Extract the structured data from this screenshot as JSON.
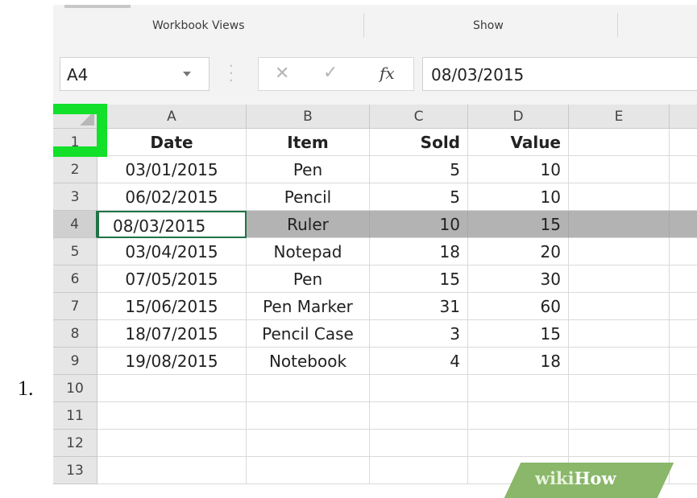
{
  "step_number": "1.",
  "ribbon": {
    "groups": [
      "Workbook Views",
      "Show"
    ]
  },
  "formula_bar": {
    "name_box": "A4",
    "cancel_icon": "✕",
    "enter_icon": "✓",
    "fx_label": "fx",
    "value": "08/03/2015"
  },
  "columns": [
    "A",
    "B",
    "C",
    "D",
    "E"
  ],
  "rows": [
    {
      "num": "1",
      "cells": [
        "Date",
        "Item",
        "Sold",
        "Value",
        ""
      ]
    },
    {
      "num": "2",
      "cells": [
        "03/01/2015",
        "Pen",
        "5",
        "10",
        ""
      ]
    },
    {
      "num": "3",
      "cells": [
        "06/02/2015",
        "Pencil",
        "5",
        "10",
        ""
      ]
    },
    {
      "num": "4",
      "cells": [
        "08/03/2015",
        "Ruler",
        "10",
        "15",
        ""
      ]
    },
    {
      "num": "5",
      "cells": [
        "03/04/2015",
        "Notepad",
        "18",
        "20",
        ""
      ]
    },
    {
      "num": "6",
      "cells": [
        "07/05/2015",
        "Pen",
        "15",
        "30",
        ""
      ]
    },
    {
      "num": "7",
      "cells": [
        "15/06/2015",
        "Pen Marker",
        "31",
        "60",
        ""
      ]
    },
    {
      "num": "8",
      "cells": [
        "18/07/2015",
        "Pencil Case",
        "3",
        "15",
        ""
      ]
    },
    {
      "num": "9",
      "cells": [
        "19/08/2015",
        "Notebook",
        "4",
        "18",
        ""
      ]
    },
    {
      "num": "10",
      "cells": [
        "",
        "",
        "",
        "",
        ""
      ]
    },
    {
      "num": "11",
      "cells": [
        "",
        "",
        "",
        "",
        ""
      ]
    },
    {
      "num": "12",
      "cells": [
        "",
        "",
        "",
        "",
        ""
      ]
    },
    {
      "num": "13",
      "cells": [
        "",
        "",
        "",
        "",
        ""
      ]
    }
  ],
  "selected_row": "4",
  "watermark": {
    "wiki": "wiki",
    "how": "How"
  },
  "colors": {
    "accent": "#217346",
    "highlight": "#12e02a",
    "selection": "#b3b3b3",
    "watermark": "#8ab76a"
  }
}
